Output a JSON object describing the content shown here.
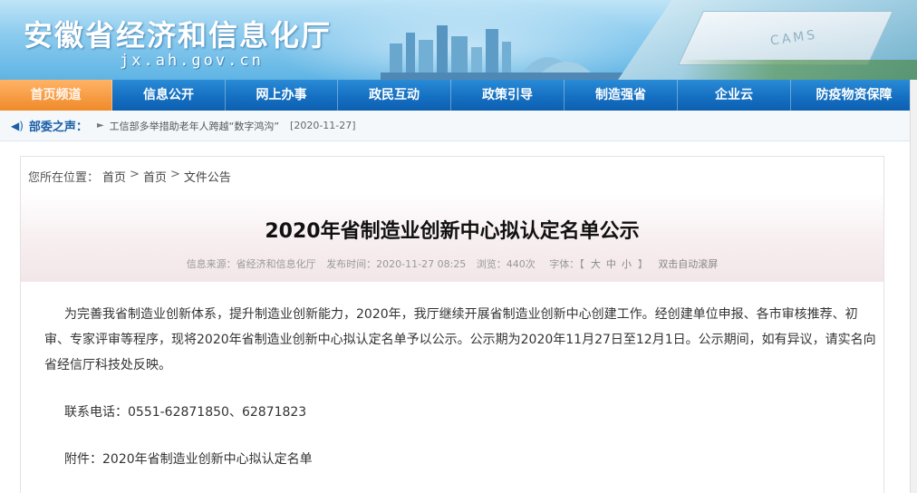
{
  "header": {
    "site_title": "安徽省经济和信息化厅",
    "site_domain": "jx.ah.gov.cn",
    "banner_text": "CAMS"
  },
  "nav": {
    "items": [
      {
        "label": "首页频道",
        "active": true
      },
      {
        "label": "信息公开"
      },
      {
        "label": "网上办事"
      },
      {
        "label": "政民互动"
      },
      {
        "label": "政策引导"
      },
      {
        "label": "制造强省"
      },
      {
        "label": "企业云"
      },
      {
        "label": "防疫物资保障"
      }
    ]
  },
  "notice": {
    "label": "部委之声：",
    "news": "工信部多举措助老年人跨越“数字鸿沟”",
    "date": "[2020-11-27]"
  },
  "breadcrumb": {
    "prefix": "您所在位置：",
    "items": [
      "首页",
      "首页",
      "文件公告"
    ],
    "separator": ">"
  },
  "article": {
    "title": "2020年省制造业创新中心拟认定名单公示",
    "meta": {
      "source": "信息来源：省经济和信息化厅",
      "publish_time": "发布时间：2020-11-27 08:25",
      "views": "浏览：440次",
      "font_label": "字体：【",
      "size_large": "大",
      "size_medium": "中",
      "size_small": "小",
      "font_close": "】",
      "auto_scroll": "双击自动滚屏"
    },
    "paragraph_lines": [
      "为完善我省制造业创新体系，提升制造业创新能力，2020年，我厅继续开展省制造业创新中心创建工作。经创建单位申报、各市审核推荐、初",
      "审、专家评审等程序，现将2020年省制造业创新中心拟认定名单予以公示。公示期为2020年11月27日至12月1日。公示期间，如有异议，请实名向",
      "省经信厅科技处反映。"
    ],
    "contact": "联系电话：0551-62871850、62871823",
    "attachment_label": "附件：",
    "attachment_name": "2020年省制造业创新中心拟认定名单"
  },
  "colors": {
    "nav_blue": "#1570c2",
    "notice_blue": "#1a5fa8",
    "active_orange": "#f08a2a"
  }
}
